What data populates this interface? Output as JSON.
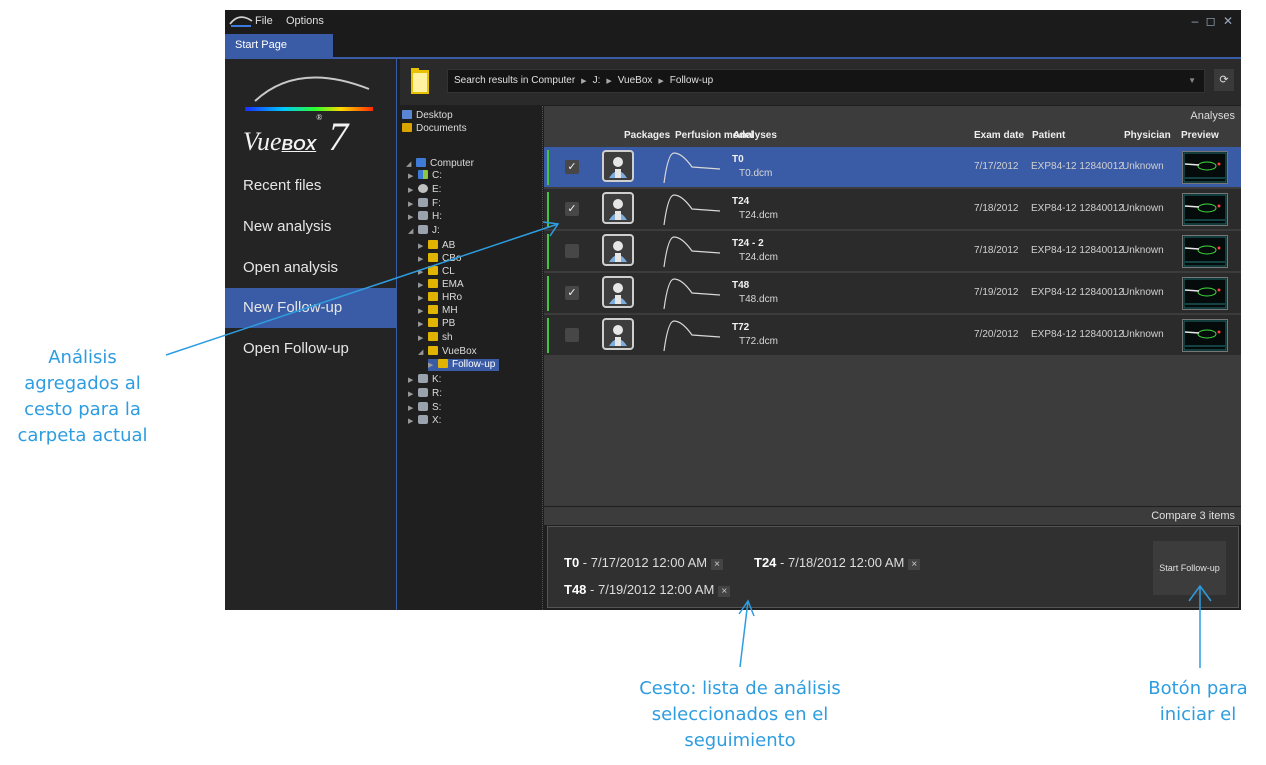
{
  "app": {
    "menu": [
      "File",
      "Options"
    ],
    "window_controls": "– ◻ ✕",
    "tab": "Start Page"
  },
  "logo": {
    "text": "Vue",
    "box": "BOX",
    "reg": "®",
    "version": "7"
  },
  "nav": {
    "items": [
      {
        "label": "Recent files",
        "active": false
      },
      {
        "label": "New analysis",
        "active": false
      },
      {
        "label": "Open analysis",
        "active": false
      },
      {
        "label": "New Follow-up",
        "active": true
      },
      {
        "label": "Open Follow-up",
        "active": false
      }
    ]
  },
  "path": {
    "prefix": "Search results in",
    "segments": [
      "Computer",
      "J:",
      "VueBox",
      "Follow-up"
    ],
    "refresh_icon": "⟳"
  },
  "tree": {
    "items": [
      {
        "label": "Desktop",
        "icon": "desktop-icon",
        "depth": 0,
        "arrow": ""
      },
      {
        "label": "Documents",
        "icon": "documents-icon",
        "depth": 0,
        "arrow": ""
      },
      {
        "label": "Computer",
        "icon": "computer-icon",
        "depth": 0,
        "arrow": "◢"
      },
      {
        "label": "C:",
        "icon": "os-drive-icon",
        "depth": 1,
        "arrow": "▶"
      },
      {
        "label": "E:",
        "icon": "disc-icon",
        "depth": 1,
        "arrow": "▶"
      },
      {
        "label": "F:",
        "icon": "drive-icon",
        "depth": 1,
        "arrow": "▶"
      },
      {
        "label": "H:",
        "icon": "network-drive-icon",
        "depth": 1,
        "arrow": "▶"
      },
      {
        "label": "J:",
        "icon": "network-drive-icon",
        "depth": 1,
        "arrow": "◢"
      },
      {
        "label": "AB",
        "icon": "folder-icon",
        "depth": 2,
        "arrow": "▶"
      },
      {
        "label": "CBo",
        "icon": "folder-icon",
        "depth": 2,
        "arrow": "▶"
      },
      {
        "label": "CL",
        "icon": "folder-icon",
        "depth": 2,
        "arrow": "▶"
      },
      {
        "label": "EMA",
        "icon": "folder-icon",
        "depth": 2,
        "arrow": "▶"
      },
      {
        "label": "HRo",
        "icon": "folder-icon",
        "depth": 2,
        "arrow": "▶"
      },
      {
        "label": "MH",
        "icon": "folder-icon",
        "depth": 2,
        "arrow": "▶"
      },
      {
        "label": "PB",
        "icon": "folder-icon",
        "depth": 2,
        "arrow": "▶"
      },
      {
        "label": "sh",
        "icon": "folder-icon",
        "depth": 2,
        "arrow": "▶"
      },
      {
        "label": "VueBox",
        "icon": "folder-icon",
        "depth": 2,
        "arrow": "◢"
      },
      {
        "label": "Follow-up",
        "icon": "folder-icon",
        "depth": 3,
        "arrow": "▶",
        "selected": true
      },
      {
        "label": "K:",
        "icon": "network-drive-icon",
        "depth": 1,
        "arrow": "▶"
      },
      {
        "label": "R:",
        "icon": "network-drive-icon",
        "depth": 1,
        "arrow": "▶"
      },
      {
        "label": "S:",
        "icon": "network-drive-icon",
        "depth": 1,
        "arrow": "▶"
      },
      {
        "label": "X:",
        "icon": "network-drive-icon",
        "depth": 1,
        "arrow": "▶"
      }
    ]
  },
  "grid": {
    "title": "Analyses",
    "headers": {
      "packages": "Packages",
      "perfusion": "Perfusion model",
      "analyses": "Analyses",
      "exam_date": "Exam date",
      "patient": "Patient",
      "physician": "Physician",
      "preview": "Preview"
    },
    "rows": [
      {
        "name": "T0",
        "file": "T0.dcm",
        "date": "7/17/2012",
        "patient": "EXP84-12 12840012",
        "physician": "Unknown",
        "checked": true,
        "in_basket": true,
        "selected": true
      },
      {
        "name": "T24",
        "file": "T24.dcm",
        "date": "7/18/2012",
        "patient": "EXP84-12 12840012",
        "physician": "Unknown",
        "checked": true,
        "in_basket": true,
        "selected": false
      },
      {
        "name": "T24 - 2",
        "file": "T24.dcm",
        "date": "7/18/2012",
        "patient": "EXP84-12 12840012",
        "physician": "Unknown",
        "checked": false,
        "in_basket": true,
        "selected": false
      },
      {
        "name": "T48",
        "file": "T48.dcm",
        "date": "7/19/2012",
        "patient": "EXP84-12 12840012",
        "physician": "Unknown",
        "checked": true,
        "in_basket": true,
        "selected": false
      },
      {
        "name": "T72",
        "file": "T72.dcm",
        "date": "7/20/2012",
        "patient": "EXP84-12 12840012",
        "physician": "Unknown",
        "checked": false,
        "in_basket": true,
        "selected": false
      }
    ]
  },
  "compare": {
    "label": "Compare 3 items"
  },
  "basket": {
    "items": [
      {
        "name": "T0",
        "date": "- 7/17/2012 12:00 AM"
      },
      {
        "name": "T24",
        "date": "- 7/18/2012 12:00 AM"
      },
      {
        "name": "T48",
        "date": "- 7/19/2012 12:00 AM"
      }
    ],
    "remove_glyph": "×",
    "start_button": "Start Follow-up"
  },
  "annotations": {
    "left": [
      "Análisis",
      "agregados al",
      "cesto para la",
      "carpeta actual"
    ],
    "bottom": [
      "Cesto: lista de análisis",
      "seleccionados en el",
      "seguimiento"
    ],
    "right": [
      "Botón para",
      "iniciar el"
    ]
  },
  "colors": {
    "accent": "#3a5ba5",
    "green_marker": "#44c441",
    "annotation": "#2e9de0",
    "background": "#1f1f1f"
  }
}
